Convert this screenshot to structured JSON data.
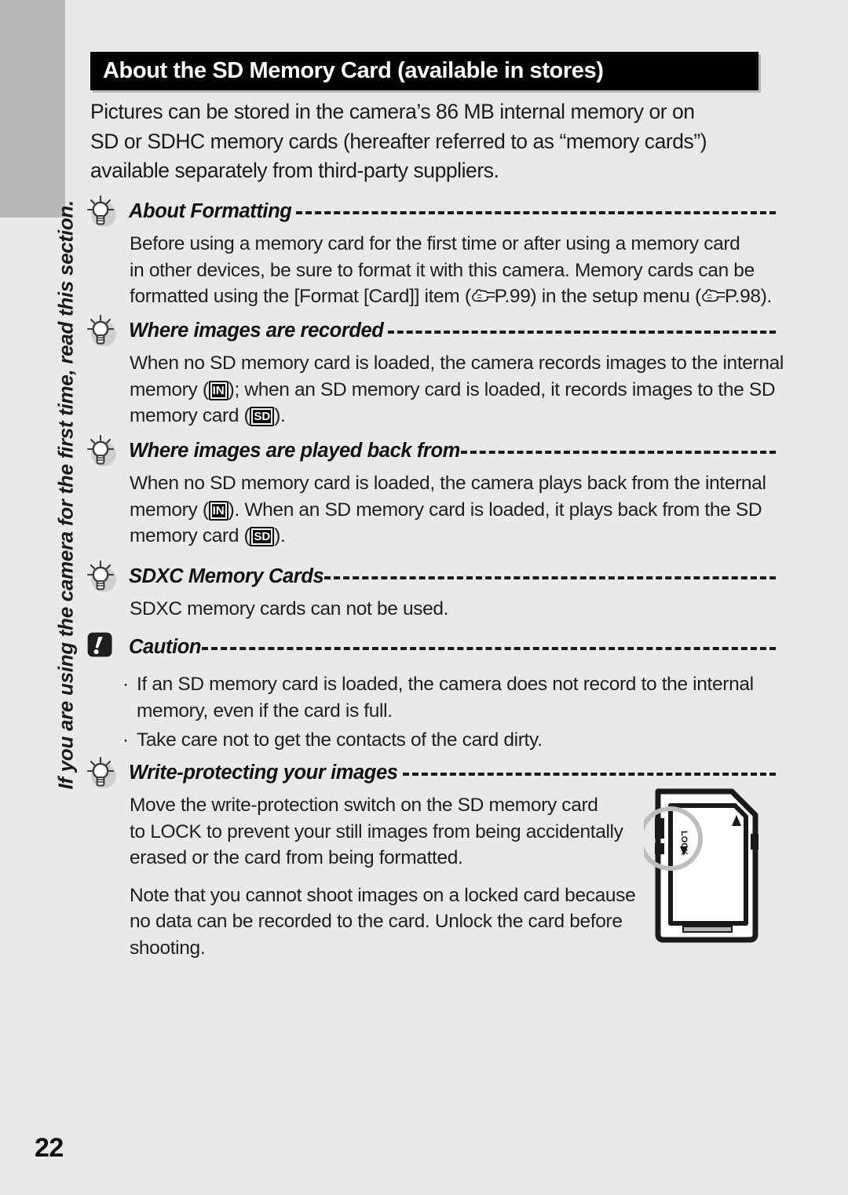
{
  "page": {
    "number": "22",
    "side_tab_text": "If you are using the camera for the first time, read this section."
  },
  "header": {
    "title": "About the SD Memory Card (available in stores)"
  },
  "intro": {
    "line1": "Pictures can be stored in the camera’s 86 MB internal memory or on",
    "line2": "SD or SDHC memory cards (hereafter referred to as “memory cards”)",
    "line3": "available separately from third-party suppliers."
  },
  "sections": {
    "formatting": {
      "icon": "lightbulb-icon",
      "heading": "About Formatting",
      "line1": "Before using a memory card for the first time or after using a memory card",
      "line2": "in other devices, be sure to format it with this camera. Memory cards can be",
      "line3_a": "formatted using the [Format [Card]] item (",
      "line3_ref1": "P.99",
      "line3_b": ") in the setup menu (",
      "line3_ref2": "P.98",
      "line3_c": ")."
    },
    "recorded": {
      "icon": "lightbulb-icon",
      "heading": "Where images are recorded",
      "line1": "When no SD memory card is loaded, the camera records images to the internal",
      "line2_a": "memory (",
      "line2_badge": "IN",
      "line2_b": "); when an SD memory card is loaded, it records images to the SD",
      "line3_a": "memory card (",
      "line3_badge": "SD",
      "line3_b": ")."
    },
    "playback": {
      "icon": "lightbulb-icon",
      "heading": "Where images are played back from",
      "line1": "When no SD memory card is loaded, the camera plays back from the internal",
      "line2_a": "memory (",
      "line2_badge": "IN",
      "line2_b": "). When an SD memory card is loaded, it plays back from the SD",
      "line3_a": "memory card (",
      "line3_badge": "SD",
      "line3_b": ")."
    },
    "sdxc": {
      "icon": "lightbulb-icon",
      "heading": "SDXC Memory Cards",
      "line1": "SDXC memory cards can not be used."
    },
    "caution": {
      "icon": "caution-icon",
      "heading": "Caution",
      "bullet1_line1": "If an SD memory card is loaded, the camera does not record to the internal",
      "bullet1_line2": "memory, even if the card is full.",
      "bullet2_line1": "Take care not to get the contacts of the card dirty.",
      "bullet_marker": "·"
    },
    "write_protect": {
      "icon": "lightbulb-icon",
      "heading": "Write-protecting your images",
      "p1_line1": "Move the write-protection switch on the SD memory card",
      "p1_line2": "to LOCK to prevent your still images from being accidentally",
      "p1_line3": "erased or the card from being formatted.",
      "p2_line1": "Note that you cannot shoot images on a locked card because",
      "p2_line2": "no data can be recorded to the card. Unlock the card before",
      "p2_line3": "shooting.",
      "illustration": {
        "name": "sd-card-diagram",
        "lock_label": "LOCK"
      }
    }
  },
  "colors": {
    "page_background": "#e9e9e9",
    "header_bar": "#000000",
    "header_text": "#ffffff",
    "thumb_tab": "#b8b8b8",
    "body_text": "#1f1f1f",
    "rule": "#1a1a1a"
  }
}
